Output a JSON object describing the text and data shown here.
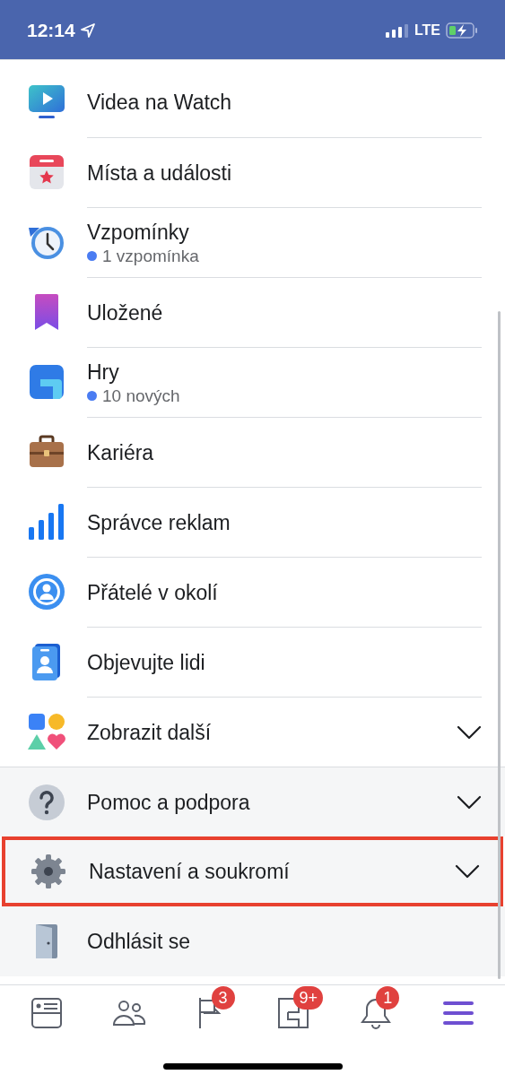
{
  "status_bar": {
    "time": "12:14",
    "network": "LTE"
  },
  "menu": {
    "items": [
      {
        "label": "Videa na Watch"
      },
      {
        "label": "Místa a události"
      },
      {
        "label": "Vzpomínky",
        "subtitle": "1 vzpomínka"
      },
      {
        "label": "Uložené"
      },
      {
        "label": "Hry",
        "subtitle": "10 nových"
      },
      {
        "label": "Kariéra"
      },
      {
        "label": "Správce reklam"
      },
      {
        "label": "Přátelé v okolí"
      },
      {
        "label": "Objevujte lidi"
      },
      {
        "label": "Zobrazit další",
        "expanded": false
      }
    ],
    "footer_items": [
      {
        "label": "Pomoc a podpora",
        "expanded": false,
        "highlighted": false
      },
      {
        "label": "Nastavení a soukromí",
        "expanded": false,
        "highlighted": true
      },
      {
        "label": "Odhlásit se",
        "highlighted": false
      }
    ]
  },
  "tab_bar": [
    {
      "selected": false
    },
    {
      "selected": false
    },
    {
      "badge": "3",
      "selected": false
    },
    {
      "badge": "9+",
      "selected": false
    },
    {
      "badge": "1",
      "selected": false
    },
    {
      "selected": true
    }
  ]
}
